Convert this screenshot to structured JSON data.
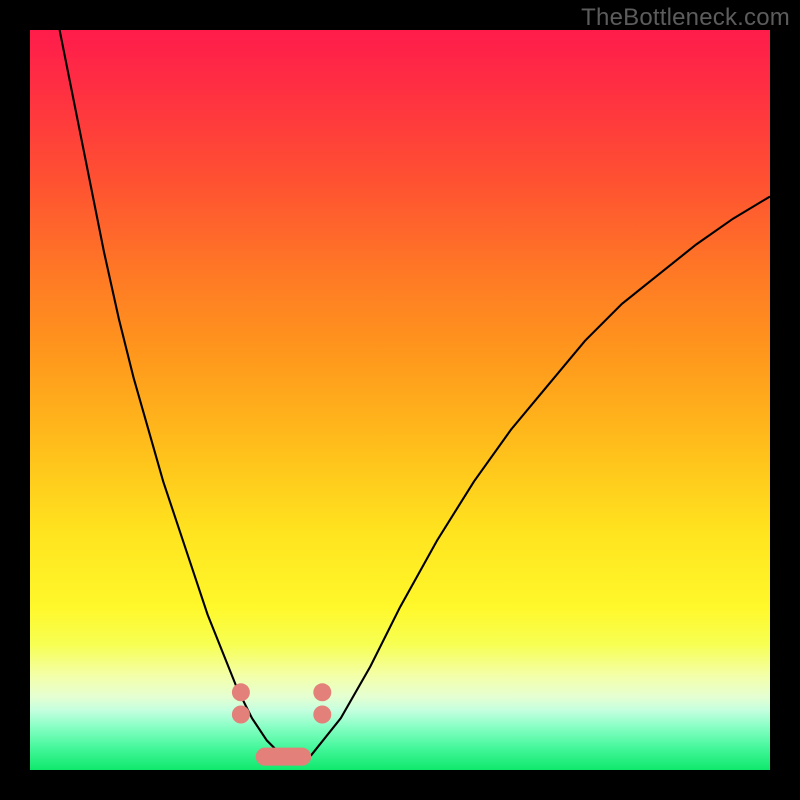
{
  "watermark": "TheBottleneck.com",
  "chart_data": {
    "type": "line",
    "title": "",
    "xlabel": "",
    "ylabel": "",
    "xlim": [
      0,
      100
    ],
    "ylim": [
      0,
      100
    ],
    "series": [
      {
        "name": "curve",
        "x": [
          4,
          6,
          8,
          10,
          12,
          14,
          16,
          18,
          20,
          22,
          24,
          26,
          28,
          30,
          32,
          34,
          36,
          38,
          42,
          46,
          50,
          55,
          60,
          65,
          70,
          75,
          80,
          85,
          90,
          95,
          100
        ],
        "y": [
          100,
          90,
          80,
          70,
          61,
          53,
          46,
          39,
          33,
          27,
          21,
          16,
          11,
          7,
          4,
          2,
          1.2,
          2,
          7,
          14,
          22,
          31,
          39,
          46,
          52,
          58,
          63,
          67,
          71,
          74.5,
          77.5
        ]
      }
    ],
    "markers": {
      "left": {
        "x": 28.5,
        "y_top": 10.5,
        "y_bot": 7.5
      },
      "right": {
        "x": 39.5,
        "y_top": 10.5,
        "y_bot": 7.5
      },
      "bottom_bar": {
        "x_start": 30.5,
        "x_end": 38.0,
        "y": 1.8
      }
    },
    "background_gradient": [
      "#ff1c4b",
      "#ffe41f",
      "#0fe86c"
    ]
  }
}
